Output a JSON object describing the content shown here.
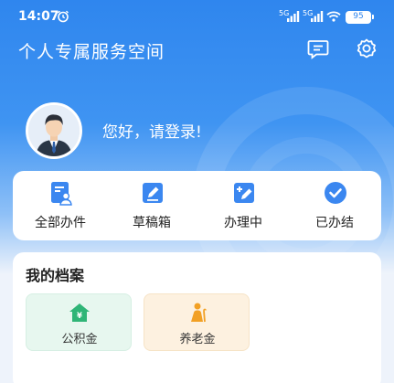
{
  "status_bar": {
    "time": "14:07",
    "signal_1": "5G",
    "signal_2": "5G",
    "battery": "95"
  },
  "header": {
    "title": "个人专属服务空间"
  },
  "user": {
    "greeting": "您好，请登录!"
  },
  "quick_actions": [
    {
      "label": "全部办件",
      "icon": "document-user-icon"
    },
    {
      "label": "草稿箱",
      "icon": "edit-draft-icon"
    },
    {
      "label": "办理中",
      "icon": "processing-edit-icon"
    },
    {
      "label": "已办结",
      "icon": "check-circle-icon"
    }
  ],
  "archive": {
    "title": "我的档案",
    "tiles": [
      {
        "label": "公积金",
        "icon": "housing-fund-icon",
        "color": "#2fb577"
      },
      {
        "label": "养老金",
        "icon": "pension-elder-icon",
        "color": "#f2a024"
      }
    ]
  },
  "colors": {
    "primary": "#2f86ee",
    "icon_blue": "#3b87f0"
  }
}
